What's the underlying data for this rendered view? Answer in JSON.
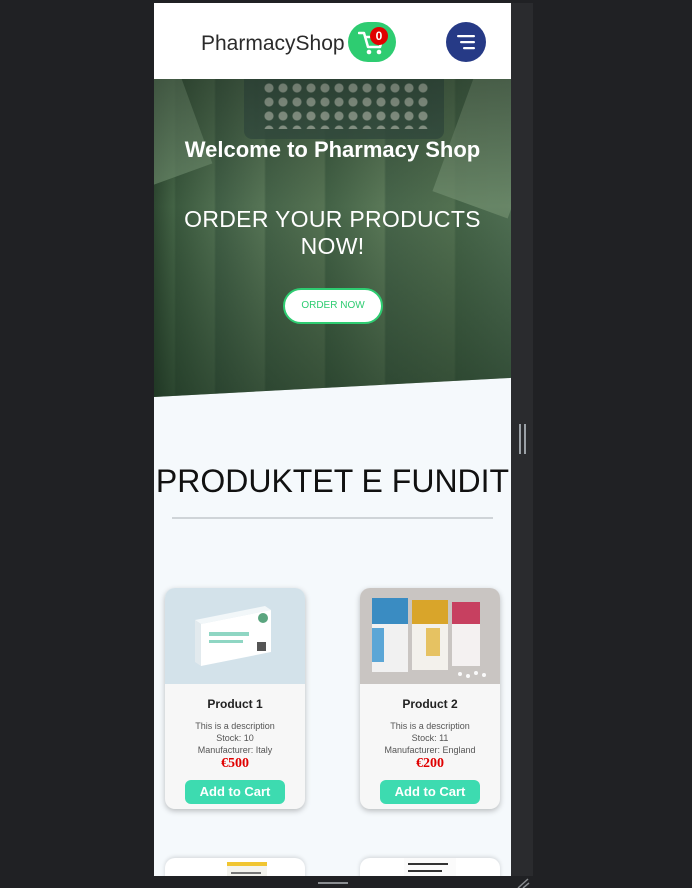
{
  "navbar": {
    "brand": "PharmacyShop",
    "cart_count": "0",
    "cart_icon": "cart-icon",
    "menu_icon": "menu-icon",
    "cart_color": "#2ecc71",
    "menu_color": "#263a86"
  },
  "hero": {
    "title": "Welcome to Pharmacy Shop",
    "subtitle": "ORDER YOUR PRODUCTS NOW!",
    "order_button": "ORDER NOW"
  },
  "section": {
    "title": "PRODUKTET E FUNDIT"
  },
  "products": [
    {
      "name": "Product 1",
      "description": "This is a description",
      "stock": "Stock: 10",
      "manufacturer": "Manufacturer: Italy",
      "price": "€500",
      "button": "Add to Cart"
    },
    {
      "name": "Product 2",
      "description": "This is a description",
      "stock": "Stock: 11",
      "manufacturer": "Manufacturer: England",
      "price": "€200",
      "button": "Add to Cart"
    }
  ],
  "colors": {
    "accent": "#2ecc71",
    "add_to_cart": "#3ddbb0",
    "price": "#e00000",
    "cart_badge": "#e00000"
  }
}
